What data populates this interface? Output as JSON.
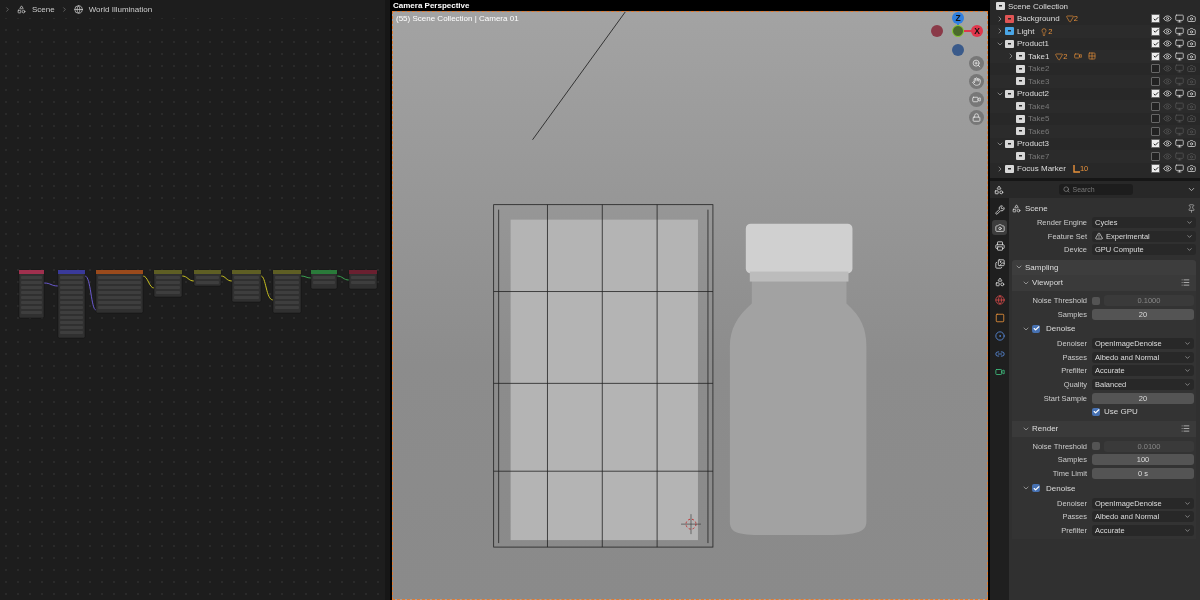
{
  "breadcrumb": [
    {
      "label": "Scene"
    },
    {
      "label": "World Illumination"
    }
  ],
  "viewport": {
    "title": "Camera Perspective",
    "info": "(55) Scene Collection | Camera 01",
    "axes": [
      {
        "label": "Z",
        "color": "#2f7fe0"
      },
      {
        "label": "X",
        "color": "#e0364c"
      }
    ]
  },
  "outliner": {
    "root": "Scene Collection",
    "items": [
      {
        "name": "Background",
        "color": "#e05555",
        "expanded": false,
        "checked": true,
        "badges": [
          {
            "kind": "mesh",
            "count": "2"
          }
        ]
      },
      {
        "name": "Light",
        "color": "#4aa6e6",
        "expanded": false,
        "checked": true,
        "badges": [
          {
            "kind": "light",
            "count": "2"
          }
        ]
      },
      {
        "name": "Product1",
        "color": "#d8d8d8",
        "expanded": true,
        "checked": true,
        "children": [
          {
            "name": "Take1",
            "color": "#d8d8d8",
            "expanded": false,
            "checked": true,
            "badges": [
              {
                "kind": "mesh",
                "count": "2"
              },
              {
                "kind": "camera"
              },
              {
                "kind": "material"
              }
            ]
          },
          {
            "name": "Take2",
            "color": "#d8d8d8",
            "checked": false
          },
          {
            "name": "Take3",
            "color": "#d8d8d8",
            "checked": false
          }
        ]
      },
      {
        "name": "Product2",
        "color": "#d8d8d8",
        "expanded": true,
        "checked": true,
        "children": [
          {
            "name": "Take4",
            "color": "#d8d8d8",
            "checked": false
          },
          {
            "name": "Take5",
            "color": "#d8d8d8",
            "checked": false
          },
          {
            "name": "Take6",
            "color": "#d8d8d8",
            "checked": false
          }
        ]
      },
      {
        "name": "Product3",
        "color": "#d8d8d8",
        "expanded": true,
        "checked": true,
        "children": [
          {
            "name": "Take7",
            "color": "#d8d8d8",
            "checked": false
          }
        ]
      },
      {
        "name": "Focus Marker",
        "color": "#d8d8d8",
        "expanded": false,
        "checked": true,
        "badges": [
          {
            "kind": "empty",
            "count": "10"
          }
        ]
      }
    ]
  },
  "properties": {
    "search_placeholder": "Search",
    "context": "Scene",
    "tabs": [
      {
        "kind": "tool",
        "selected": false
      },
      {
        "kind": "render",
        "selected": true
      },
      {
        "kind": "output",
        "selected": false
      },
      {
        "kind": "view-layer",
        "selected": false
      },
      {
        "kind": "scene",
        "selected": false
      },
      {
        "kind": "world",
        "selected": false
      },
      {
        "kind": "object",
        "selected": false
      },
      {
        "kind": "modifier",
        "selected": false
      },
      {
        "kind": "constraint",
        "selected": false
      },
      {
        "kind": "data",
        "selected": false
      }
    ],
    "rows": [
      {
        "kind": "dropdown",
        "label": "Render Engine",
        "value": "Cycles"
      },
      {
        "kind": "alert-dropdown",
        "label": "Feature Set",
        "value": "Experimental"
      },
      {
        "kind": "dropdown",
        "label": "Device",
        "value": "GPU Compute"
      }
    ],
    "panels": [
      {
        "title": "Sampling",
        "expanded": true,
        "subpanels": [
          {
            "title": "Viewport",
            "expanded": true,
            "rows": [
              {
                "kind": "toggle-number",
                "label": "Noise Threshold",
                "checked": false,
                "value": "0.1000"
              },
              {
                "kind": "number",
                "label": "Samples",
                "value": "20"
              }
            ],
            "sections": [
              {
                "title": "Denoise",
                "expanded": true,
                "checked": true,
                "rows": [
                  {
                    "kind": "dropdown",
                    "label": "Denoiser",
                    "value": "OpenImageDenoise"
                  },
                  {
                    "kind": "dropdown",
                    "label": "Passes",
                    "value": "Albedo and Normal"
                  },
                  {
                    "kind": "dropdown",
                    "label": "Prefilter",
                    "value": "Accurate"
                  },
                  {
                    "kind": "dropdown",
                    "label": "Quality",
                    "value": "Balanced"
                  },
                  {
                    "kind": "number",
                    "label": "Start Sample",
                    "value": "20"
                  },
                  {
                    "kind": "checkbox",
                    "label": "Use GPU",
                    "checked": true
                  }
                ]
              }
            ]
          },
          {
            "title": "Render",
            "expanded": true,
            "rows": [
              {
                "kind": "toggle-number",
                "label": "Noise Threshold",
                "checked": false,
                "value": "0.0100"
              },
              {
                "kind": "number",
                "label": "Samples",
                "value": "100"
              },
              {
                "kind": "number",
                "label": "Time Limit",
                "value": "0 s"
              }
            ],
            "sections": [
              {
                "title": "Denoise",
                "expanded": true,
                "checked": true,
                "rows": [
                  {
                    "kind": "dropdown",
                    "label": "Denoiser",
                    "value": "OpenImageDenoise"
                  },
                  {
                    "kind": "dropdown",
                    "label": "Passes",
                    "value": "Albedo and Normal"
                  },
                  {
                    "kind": "dropdown",
                    "label": "Prefilter",
                    "value": "Accurate"
                  }
                ]
              }
            ]
          }
        ]
      }
    ]
  }
}
